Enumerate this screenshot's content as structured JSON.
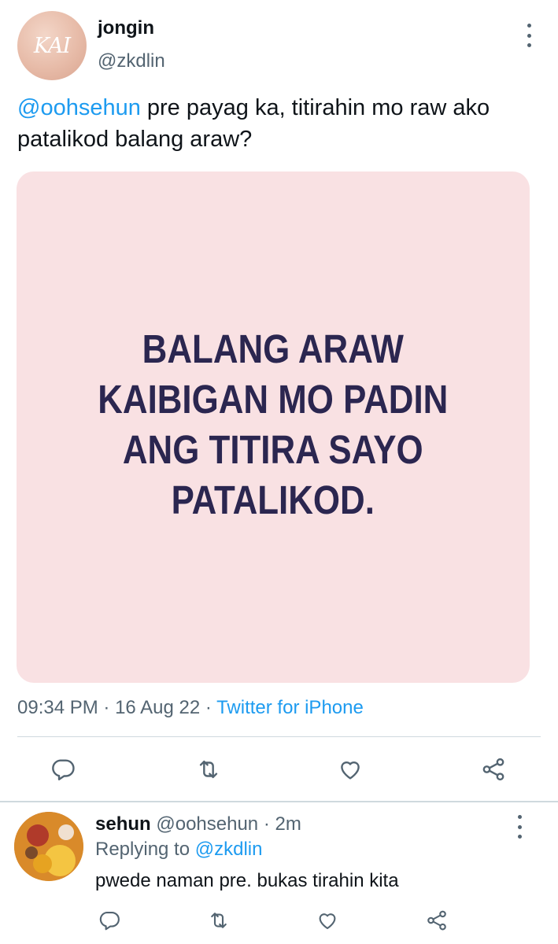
{
  "tweet": {
    "author_name": "jongin",
    "author_handle": "@zkdlin",
    "avatar_initials": "KAI",
    "text_mention": "@oohsehun",
    "text_body": " pre payag ka, titirahin mo raw ako patalikod balang araw?",
    "image_text": "BALANG ARAW\nKAIBIGAN MO PADIN\nANG TITIRA SAYO\nPATALIKOD.",
    "time": "09:34 PM",
    "date": "16 Aug 22",
    "separator": " · ",
    "source": "Twitter for iPhone",
    "actions": [
      "reply",
      "retweet",
      "like",
      "share"
    ]
  },
  "reply": {
    "author_name": "sehun",
    "author_handle": "@oohsehun",
    "time_ago": "2m",
    "replying_prefix": "Replying to ",
    "replying_to": "@zkdlin",
    "text": "pwede naman pre. bukas tirahin kita"
  },
  "colors": {
    "accent": "#1d9bf0",
    "secondary_text": "#536471",
    "image_bg": "#f9e1e3",
    "image_text": "#2b2650"
  },
  "icons": [
    "more-icon",
    "reply-icon",
    "retweet-icon",
    "like-icon",
    "share-icon"
  ]
}
